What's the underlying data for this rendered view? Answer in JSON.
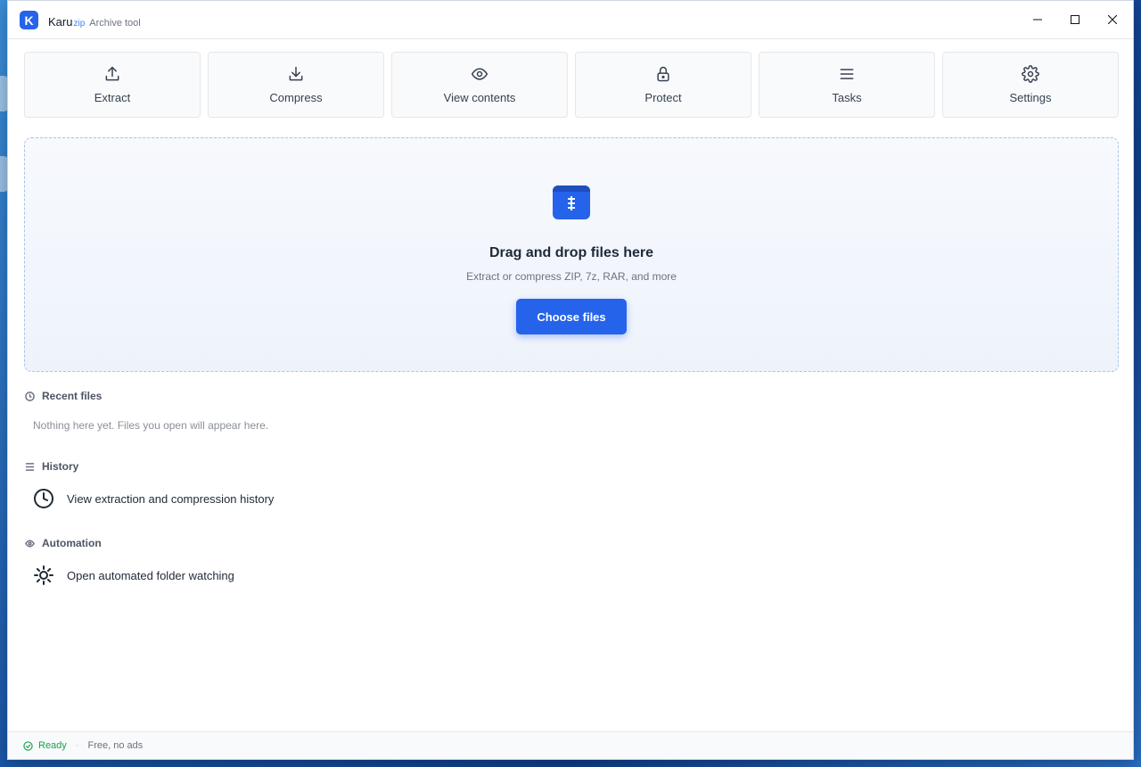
{
  "app": {
    "logo_letter": "K",
    "name": "Karu",
    "name_suffix": "zip",
    "subtitle": "Archive tool"
  },
  "window_controls": {
    "minimize": "—",
    "maximize": "☐",
    "close": "✕"
  },
  "toolbar": {
    "items": [
      {
        "label": "Extract",
        "icon": "upload-icon"
      },
      {
        "label": "Compress",
        "icon": "download-icon"
      },
      {
        "label": "View contents",
        "icon": "eye-icon"
      },
      {
        "label": "Protect",
        "icon": "lock-icon"
      },
      {
        "label": "Tasks",
        "icon": "list-icon"
      },
      {
        "label": "Settings",
        "icon": "gear-icon"
      }
    ]
  },
  "dropzone": {
    "title": "Drag and drop files here",
    "subtitle": "Extract or compress ZIP, 7z, RAR, and more",
    "button_label": "Choose files"
  },
  "recent": {
    "heading": "Recent files",
    "empty_text": "Nothing here yet. Files you open will appear here."
  },
  "history": {
    "heading": "History",
    "action_label": "View extraction and compression history"
  },
  "automation": {
    "heading": "Automation",
    "action_label": "Open automated folder watching"
  },
  "status": {
    "ready": "Ready",
    "separator": "·",
    "note": "Free, no ads"
  },
  "colors": {
    "accent": "#2563eb",
    "ready_green": "#16a34a"
  }
}
